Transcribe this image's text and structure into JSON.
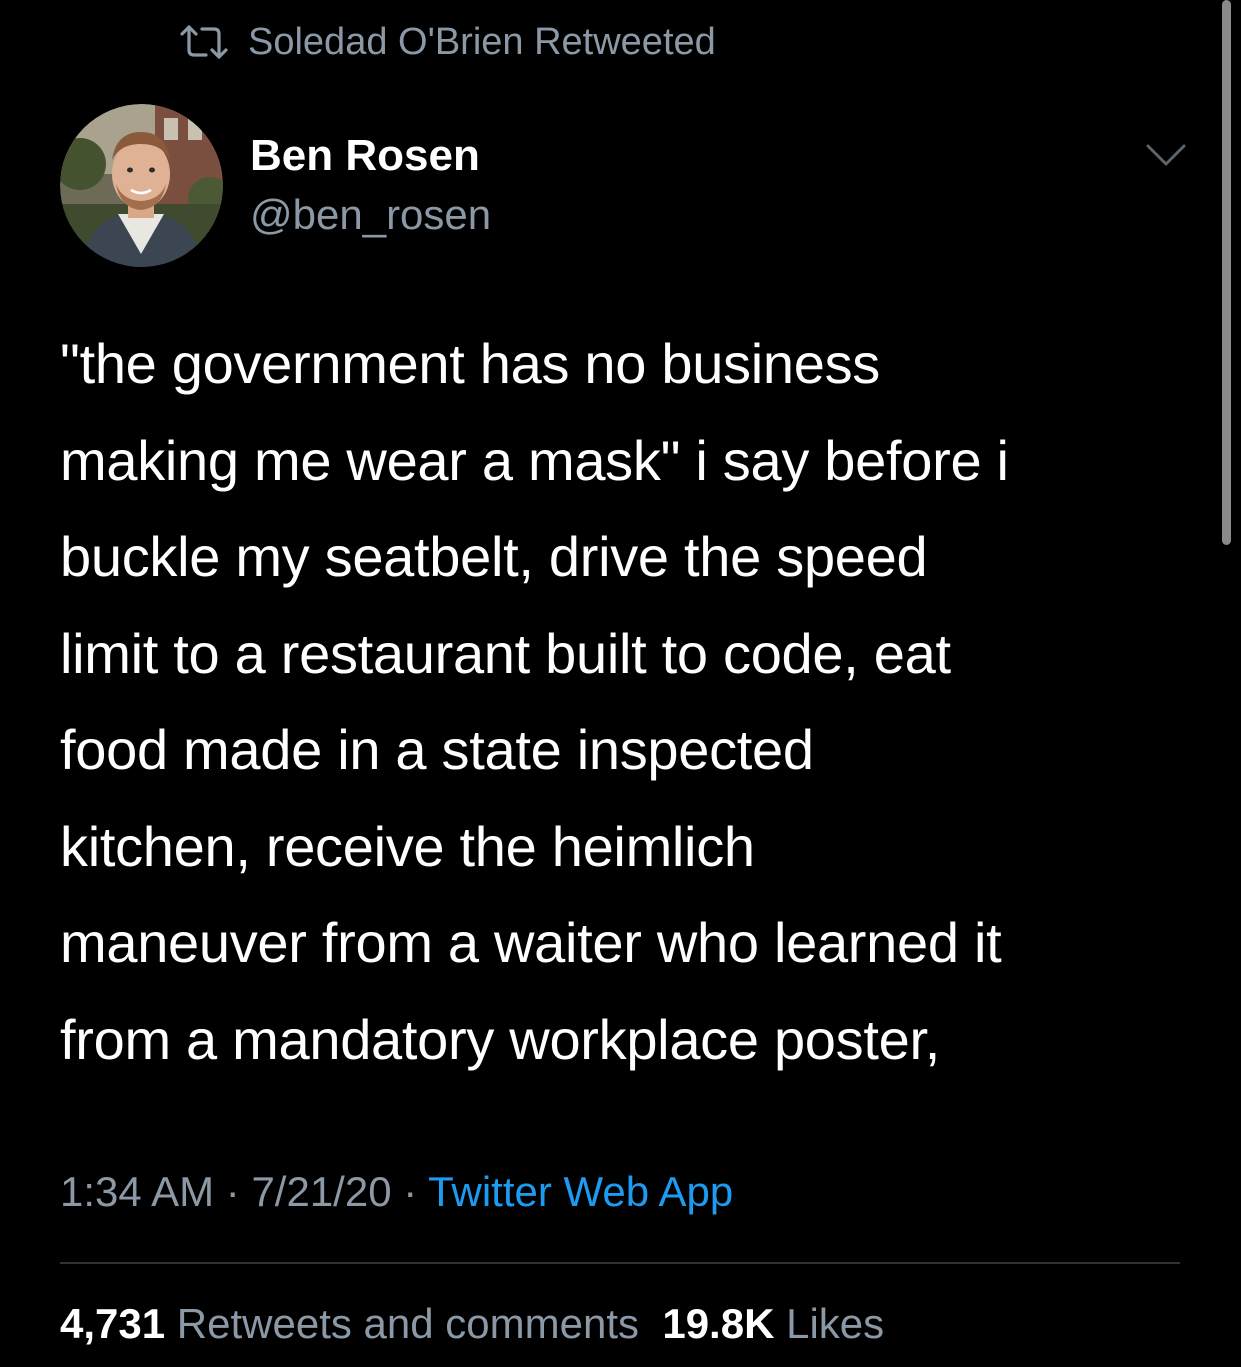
{
  "retweet": {
    "icon": "retweet-icon",
    "label": "Soledad O'Brien Retweeted"
  },
  "author": {
    "display_name": "Ben Rosen",
    "handle": "@ben_rosen",
    "avatar": "avatar-photo"
  },
  "menu": {
    "icon": "chevron-down-icon"
  },
  "tweet": {
    "text": "\"the government has no business\nmaking me wear a mask\" i say before i\nbuckle my seatbelt, drive the speed\nlimit to a restaurant built to code, eat\nfood made in a state inspected\nkitchen, receive the heimlich\nmaneuver from a waiter who learned it\nfrom a mandatory workplace poster,"
  },
  "meta": {
    "time": "1:34 AM",
    "sep1": " · ",
    "date": "7/21/20",
    "sep2": " · ",
    "source": "Twitter Web App"
  },
  "stats": {
    "retweets_count": "4,731",
    "retweets_label": "Retweets and comments",
    "likes_count": "19.8K",
    "likes_label": "Likes"
  },
  "colors": {
    "background": "#000000",
    "primary_text": "#ffffff",
    "secondary_text": "#8b98a5",
    "link": "#1d9bf0",
    "divider": "#2f3336"
  }
}
